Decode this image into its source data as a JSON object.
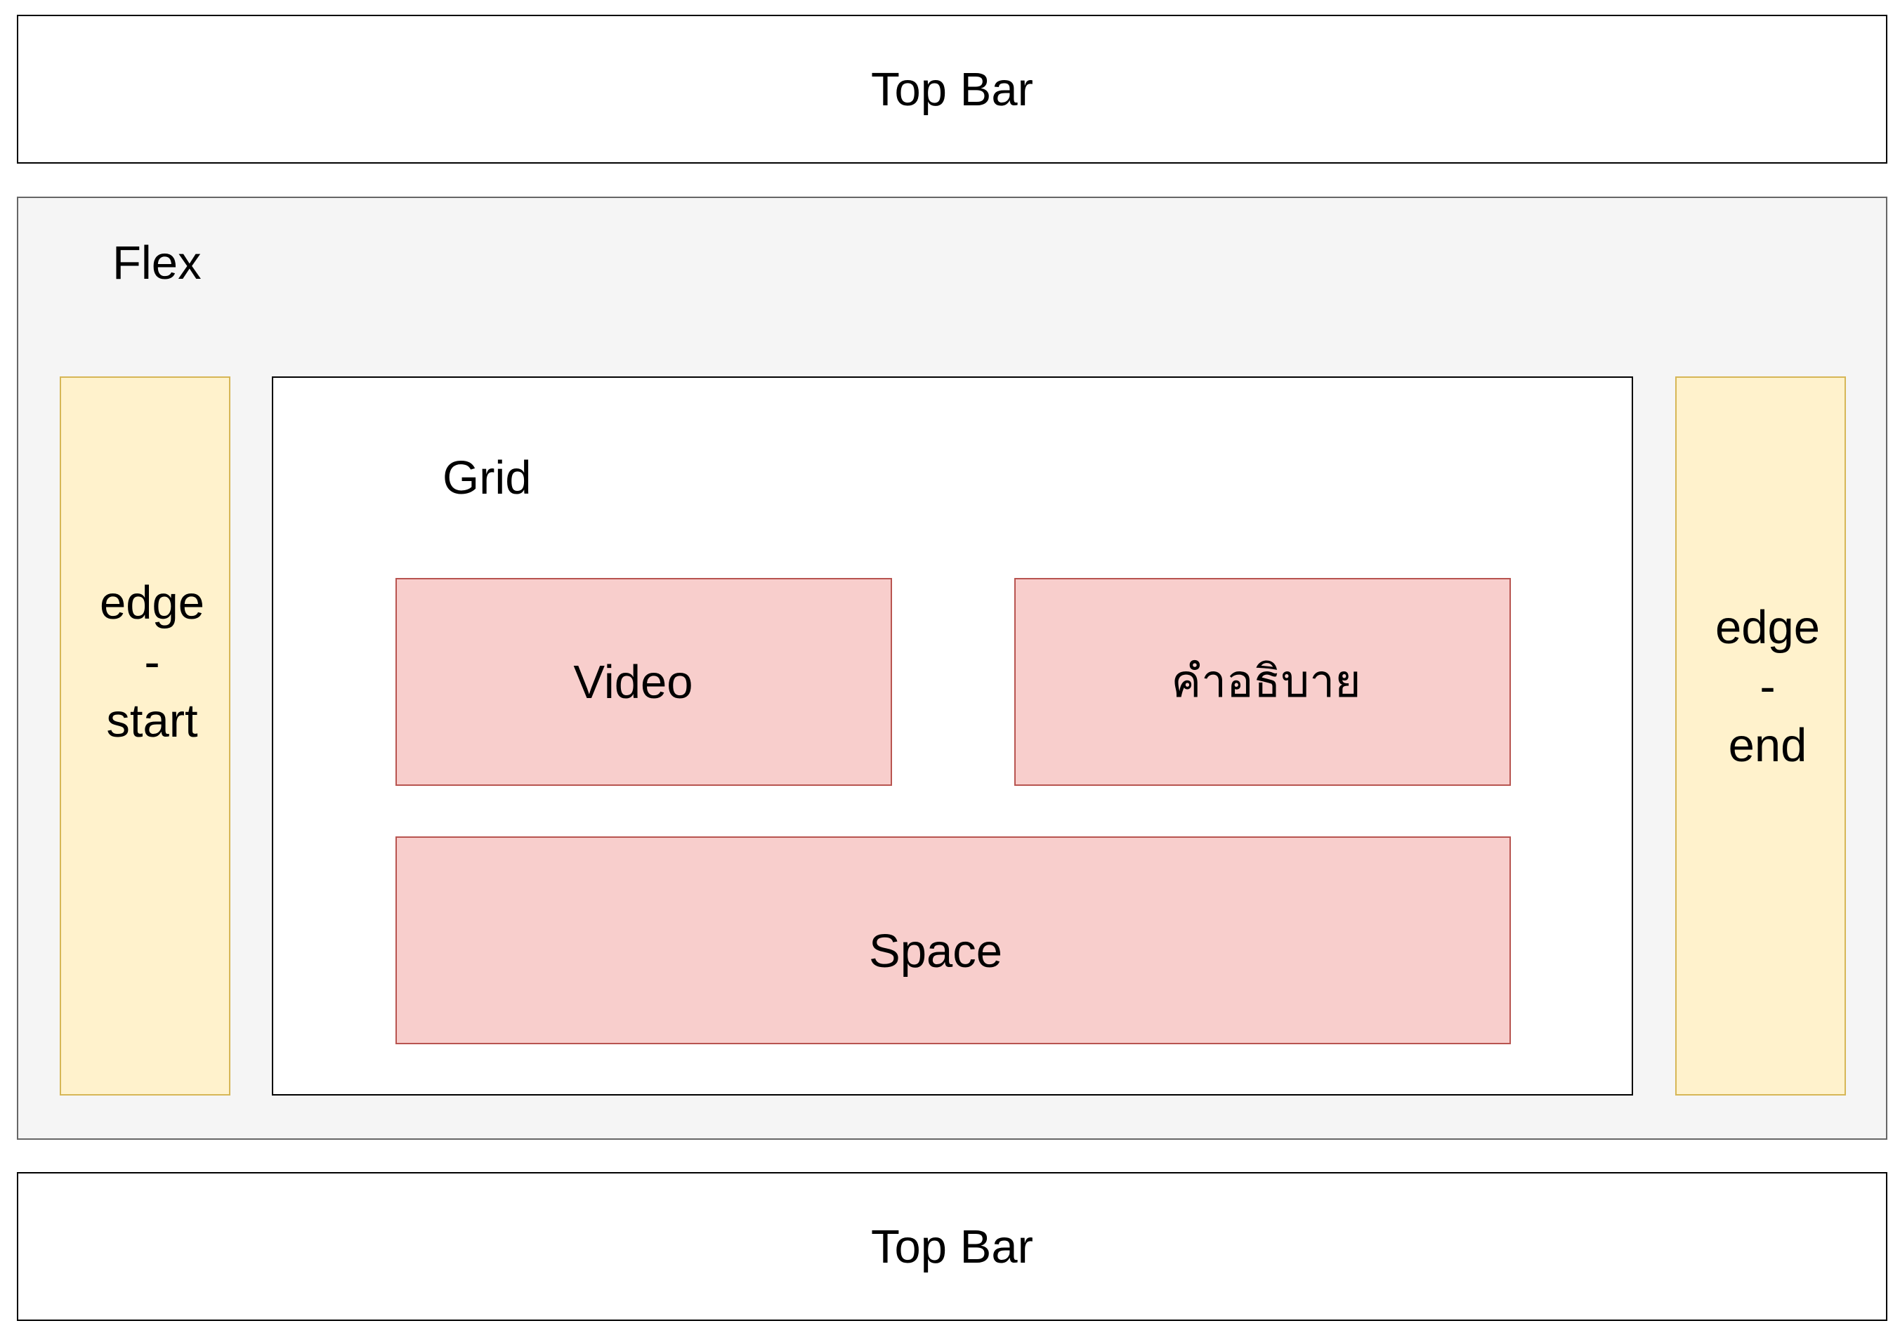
{
  "top_bar": {
    "label": "Top Bar"
  },
  "flex": {
    "label": "Flex",
    "edge_start": {
      "line1": "edge",
      "line2": "-",
      "line3": "start"
    },
    "edge_end": {
      "line1": "edge",
      "line2": "-",
      "line3": "end"
    }
  },
  "grid": {
    "label": "Grid",
    "video": "Video",
    "description": "คำอธิบาย",
    "space": "Space"
  },
  "bottom_bar": {
    "label": "Top Bar"
  },
  "colors": {
    "flex_fill": "#f5f5f5",
    "flex_stroke": "#666666",
    "edge_fill": "#fff2cc",
    "edge_stroke": "#d6b656",
    "cell_fill": "#f8cecc",
    "cell_stroke": "#b85450"
  }
}
